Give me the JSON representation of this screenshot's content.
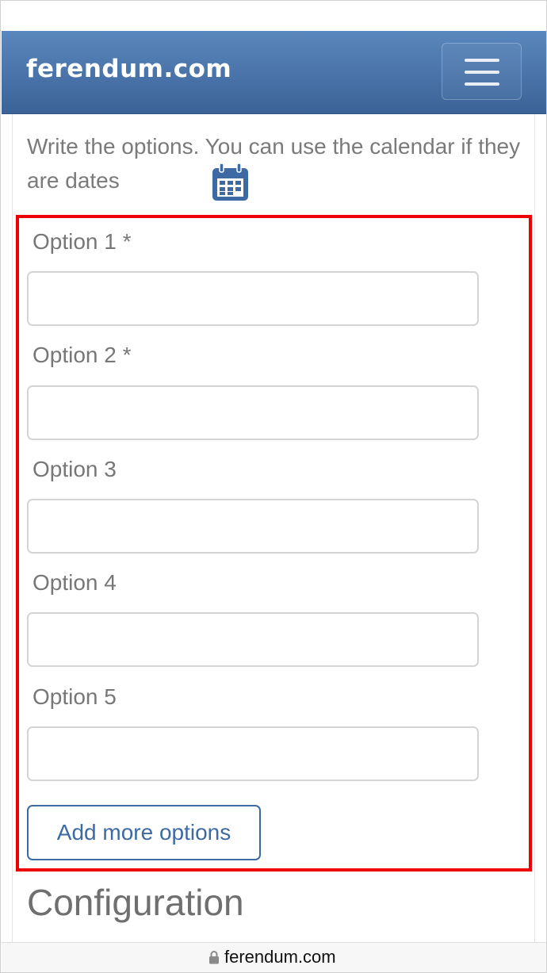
{
  "header": {
    "brand": "ferendum.com",
    "menu_icon": "hamburger-menu-icon"
  },
  "instructions": {
    "text": "Write the options. You can use the calendar if they are dates",
    "calendar_icon": "calendar-icon"
  },
  "options": [
    {
      "label": "Option 1 *",
      "value": "",
      "placeholder": ""
    },
    {
      "label": "Option 2 *",
      "value": "",
      "placeholder": ""
    },
    {
      "label": "Option 3",
      "value": "",
      "placeholder": ""
    },
    {
      "label": "Option 4",
      "value": "",
      "placeholder": ""
    },
    {
      "label": "Option 5",
      "value": "",
      "placeholder": ""
    }
  ],
  "add_more_label": "Add more options",
  "section_title": "Configuration",
  "browser": {
    "url": "ferendum.com",
    "lock_icon": "lock-icon"
  },
  "colors": {
    "navbar": "#4a76ad",
    "accent": "#3d6aa3",
    "highlight_border": "#ee0000"
  }
}
